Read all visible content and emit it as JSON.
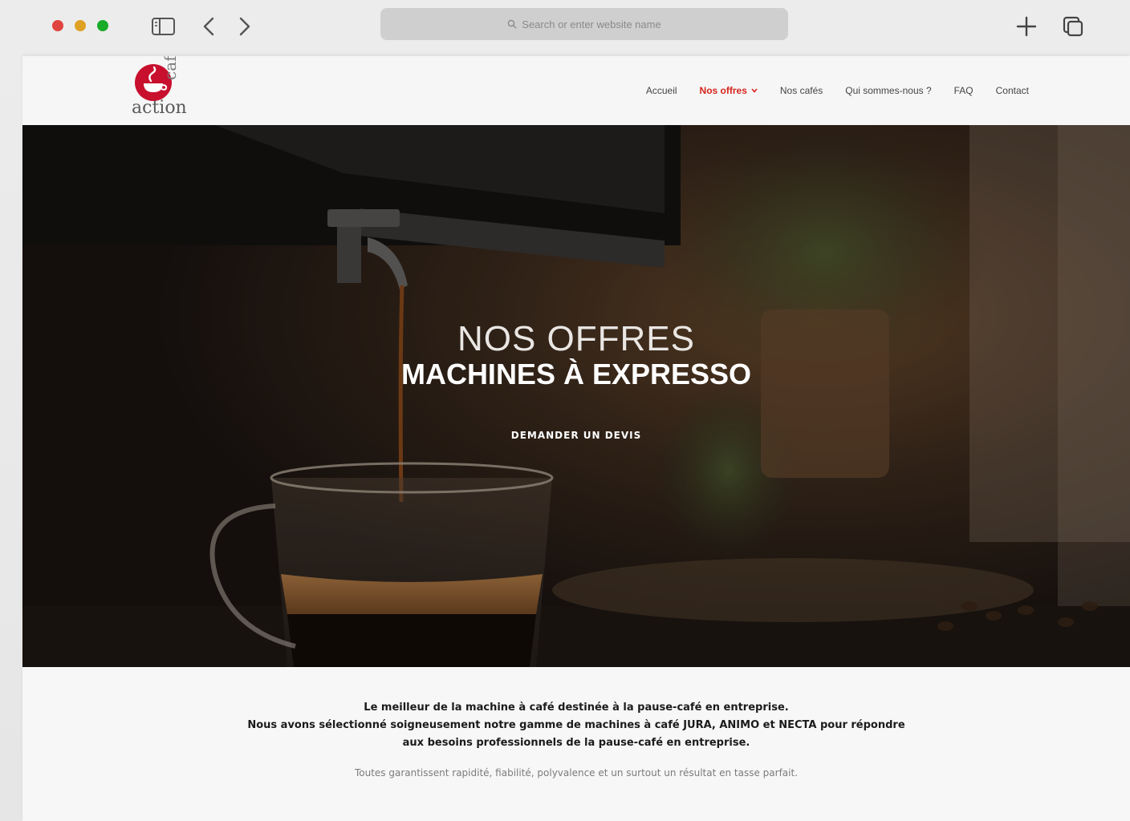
{
  "browser": {
    "address_placeholder": "Search or enter website name"
  },
  "site": {
    "logo": {
      "word_action": "action",
      "word_cafe": "café"
    },
    "nav": [
      {
        "label": "Accueil",
        "active": false
      },
      {
        "label": "Nos offres",
        "active": true,
        "has_dropdown": true
      },
      {
        "label": "Nos cafés",
        "active": false
      },
      {
        "label": "Qui sommes-nous ?",
        "active": false
      },
      {
        "label": "FAQ",
        "active": false
      },
      {
        "label": "Contact",
        "active": false
      }
    ],
    "accent_color": "#d7261e"
  },
  "hero": {
    "kicker": "NOS OFFRES",
    "title": "MACHINES À EXPRESSO",
    "cta_label": "DEMANDER UN DEVIS"
  },
  "intro": {
    "line1": "Le meilleur de la machine à café destinée à la pause-café en entreprise.",
    "line2": "Nous avons sélectionné soigneusement notre gamme de machines à café JURA, ANIMO et NECTA pour répondre",
    "line3": "aux besoins professionnels de la pause-café en entreprise.",
    "note": "Toutes garantissent rapidité, fiabilité, polyvalence et un surtout un résultat en tasse parfait."
  }
}
